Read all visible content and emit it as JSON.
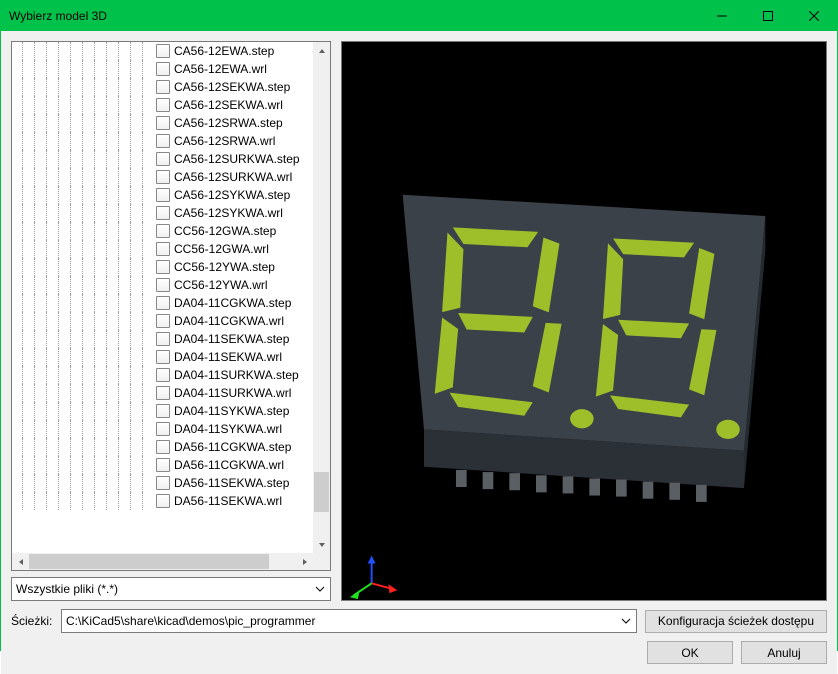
{
  "window": {
    "title": "Wybierz model 3D"
  },
  "tree": {
    "files": [
      "CA56-12EWA.step",
      "CA56-12EWA.wrl",
      "CA56-12SEKWA.step",
      "CA56-12SEKWA.wrl",
      "CA56-12SRWA.step",
      "CA56-12SRWA.wrl",
      "CA56-12SURKWA.step",
      "CA56-12SURKWA.wrl",
      "CA56-12SYKWA.step",
      "CA56-12SYKWA.wrl",
      "CC56-12GWA.step",
      "CC56-12GWA.wrl",
      "CC56-12YWA.step",
      "CC56-12YWA.wrl",
      "DA04-11CGKWA.step",
      "DA04-11CGKWA.wrl",
      "DA04-11SEKWA.step",
      "DA04-11SEKWA.wrl",
      "DA04-11SURKWA.step",
      "DA04-11SURKWA.wrl",
      "DA04-11SYKWA.step",
      "DA04-11SYKWA.wrl",
      "DA56-11CGKWA.step",
      "DA56-11CGKWA.wrl",
      "DA56-11SEKWA.step",
      "DA56-11SEKWA.wrl"
    ]
  },
  "filter": {
    "text": "Wszystkie pliki (*.*)"
  },
  "paths": {
    "label": "Ścieżki:",
    "value": "C:\\KiCad5\\share\\kicad\\demos\\pic_programmer",
    "config_button": "Konfiguracja ścieżek dostępu"
  },
  "buttons": {
    "ok": "OK",
    "cancel": "Anuluj"
  }
}
